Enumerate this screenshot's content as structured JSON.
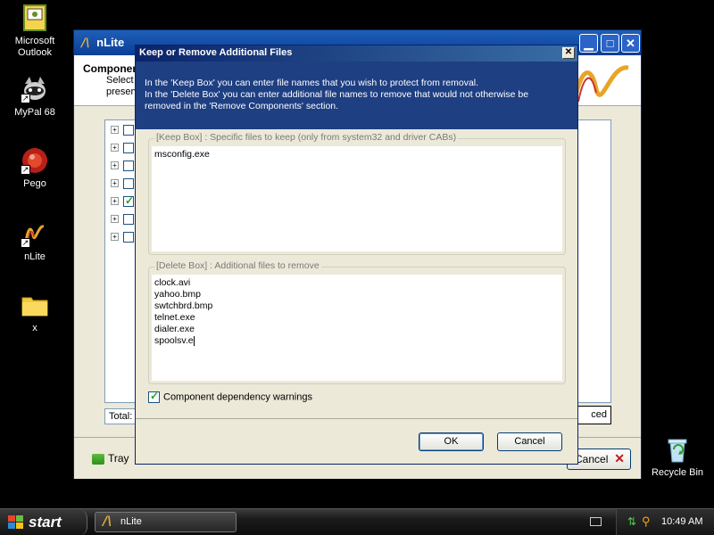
{
  "desktop": {
    "icons": [
      {
        "label_line1": "Microsoft",
        "label_line2": "Outlook",
        "icon": "outlook-icon"
      },
      {
        "label_line1": "MyPal 68",
        "icon": "mypal-icon"
      },
      {
        "label_line1": "Pego",
        "icon": "pego-icon"
      },
      {
        "label_line1": "nLite",
        "icon": "nlite-icon"
      },
      {
        "label_line1": "x",
        "icon": "folder-icon"
      },
      {
        "label_line1": "Recycle Bin",
        "icon": "recycle-bin-icon"
      }
    ]
  },
  "nlite_window": {
    "title": "nLite",
    "header_title": "Componen",
    "header_sub_1": "Select",
    "header_sub_2": "preserv",
    "total_label": "Total: (",
    "advanced_label": "ced",
    "tray_label": "Tray",
    "cancel_label": "Cancel",
    "minimize_icon": "minimize-icon",
    "maximize_icon": "maximize-icon",
    "close_icon": "close-icon"
  },
  "dialog": {
    "title": "Keep or Remove Additional Files",
    "info_line1": "In the 'Keep Box' you can enter file names that you wish to protect from removal.",
    "info_line2": "In the 'Delete Box' you can enter additional file names to remove that would not otherwise be",
    "info_line3": "removed in the 'Remove Components' section.",
    "keep_box": {
      "legend": "[Keep Box] : Specific files to keep (only from system32 and driver CABs)",
      "value": "msconfig.exe"
    },
    "delete_box": {
      "legend": "[Delete Box] : Additional files to remove",
      "value": "clock.avi\nyahoo.bmp\nswtchbrd.bmp\ntelnet.exe\ndialer.exe\nspoolsv.e"
    },
    "dependency_label": "Component dependency warnings",
    "dependency_checked": true,
    "ok_label": "OK",
    "cancel_label": "Cancel"
  },
  "taskbar": {
    "start_label": "start",
    "task_label": "nLite",
    "clock": "10:49 AM"
  },
  "colors": {
    "dialog_info_bg": "#1e3f82",
    "title_bar": "#0a246a",
    "taskbar": "#1a1a1a"
  }
}
